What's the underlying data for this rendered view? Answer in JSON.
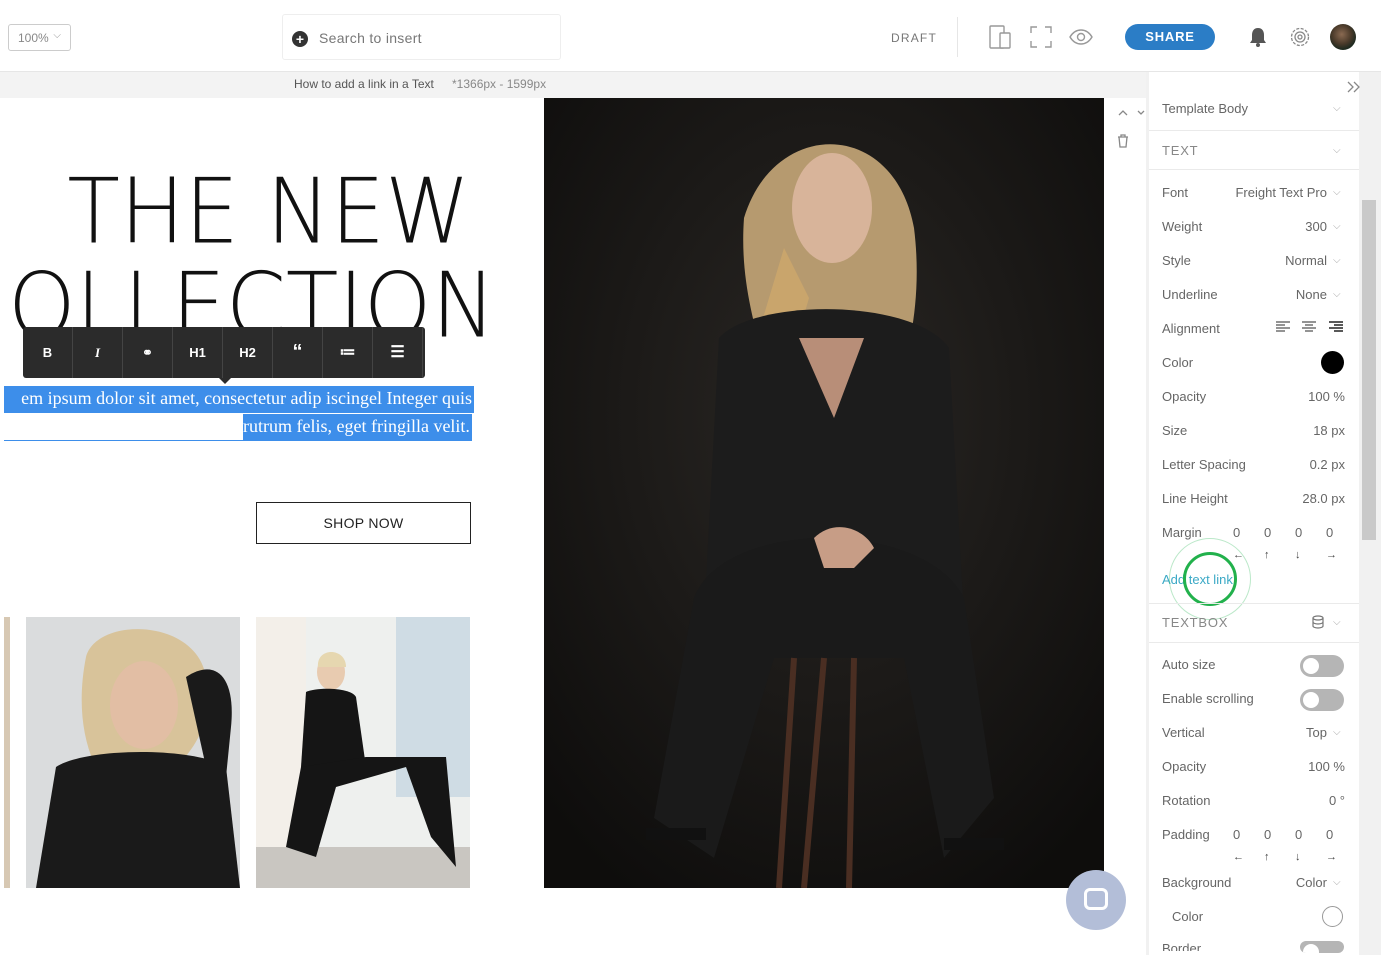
{
  "topbar": {
    "zoom": "100%",
    "search_placeholder": "Search to insert",
    "status": "DRAFT",
    "share": "SHARE",
    "icons": [
      "device-preview-icon",
      "fullscreen-icon",
      "eye-icon",
      "bell-icon",
      "gear-icon"
    ]
  },
  "subbar": {
    "page_name": "How to add a link in a Text",
    "dimensions": "*1366px - 1599px"
  },
  "canvas": {
    "headline_line1": "THE NEW",
    "headline_line2": "OLLECTION",
    "format_buttons": [
      "B",
      "I",
      "⚭",
      "H1",
      "H2",
      "“",
      "≔",
      "☰"
    ],
    "body_line1": "em ipsum dolor sit amet, consectetur adip iscingel Integer quis",
    "body_line2": "rutrum felis, eget fringilla velit.",
    "cta": "SHOP NOW"
  },
  "inspector": {
    "template": "Template Body",
    "text_section": "TEXT",
    "rows": [
      {
        "label": "Font",
        "value": "Freight Text Pro"
      },
      {
        "label": "Weight",
        "value": "300"
      },
      {
        "label": "Style",
        "value": "Normal"
      },
      {
        "label": "Underline",
        "value": "None"
      },
      {
        "label": "Alignment",
        "value": ""
      },
      {
        "label": "Color",
        "value": ""
      },
      {
        "label": "Opacity",
        "value": "100 %"
      },
      {
        "label": "Size",
        "value": "18 px"
      },
      {
        "label": "Letter Spacing",
        "value": "0.2 px"
      },
      {
        "label": "Line Height",
        "value": "28.0 px"
      },
      {
        "label": "Margin",
        "value": ""
      }
    ],
    "margin_values": [
      "0",
      "0",
      "0",
      "0"
    ],
    "add_link": "Add text link",
    "textbox_section": "TEXTBOX",
    "textbox_rows": [
      {
        "label": "Auto size",
        "value": ""
      },
      {
        "label": "Enable scrolling",
        "value": ""
      },
      {
        "label": "Vertical",
        "value": "Top"
      },
      {
        "label": "Opacity",
        "value": "100 %"
      },
      {
        "label": "Rotation",
        "value": "0 °"
      },
      {
        "label": "Padding",
        "value": ""
      },
      {
        "label": "Background",
        "value": "Color"
      },
      {
        "label": "Color",
        "value": ""
      },
      {
        "label": "Border",
        "value": ""
      }
    ],
    "padding_values": [
      "0",
      "0",
      "0",
      "0"
    ],
    "text_color": "#000000",
    "accent": "#2b7dc6"
  }
}
